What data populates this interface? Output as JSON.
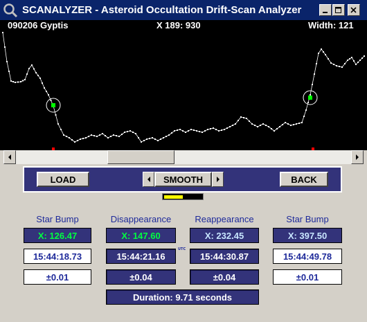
{
  "window": {
    "title": "SCANALYZER - Asteroid Occultation Drift-Scan Analyzer"
  },
  "plot": {
    "name_label": "090206 Gyptis",
    "cursor_label": "X 189: 930",
    "width_label": "Width: 121",
    "trace_color": "#ffffff",
    "marker_color": "#00ff00",
    "tick_color": "#ff0000"
  },
  "toolbar": {
    "load_label": "LOAD",
    "smooth_label": "SMOOTH",
    "back_label": "BACK",
    "smooth_level": 0.5
  },
  "columns": [
    {
      "head": "Star Bump",
      "x": "X:  126.47",
      "time": "15:44:18.73",
      "err": "±0.01"
    },
    {
      "head": "Disappearance",
      "x": "X:  147.60",
      "time": "15:44:21.16",
      "err": "±0.04"
    },
    {
      "head": "Reappearance",
      "x": "X:  232.45",
      "time": "15:44:30.87",
      "err": "±0.04"
    },
    {
      "head": "Star Bump",
      "x": "X:  397.50",
      "time": "15:44:49.78",
      "err": "±0.01"
    }
  ],
  "utc_label": "UTC",
  "duration": "Duration:  9.71  seconds",
  "colors": {
    "titlebar": "#0a246a",
    "panel": "#33337a",
    "heading": "#1e2a9a",
    "green_value": "#00ff40"
  }
}
